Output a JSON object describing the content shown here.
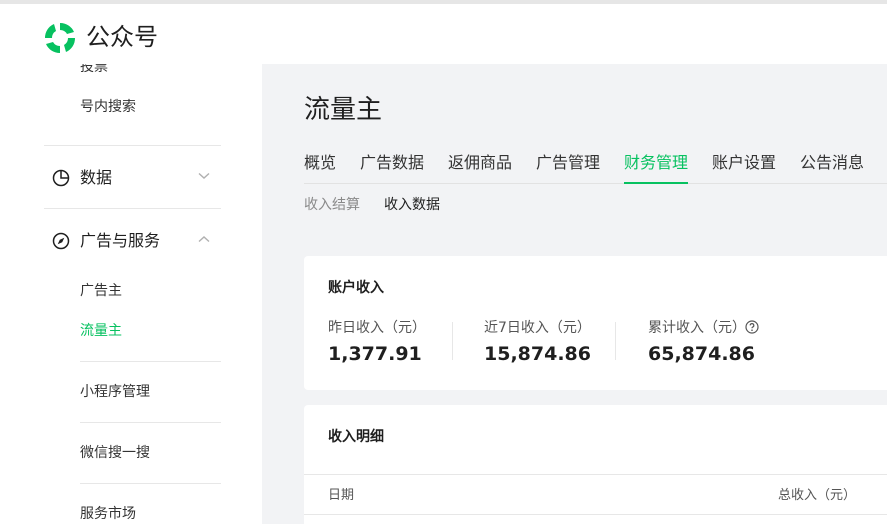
{
  "app": {
    "name": "公众号"
  },
  "colors": {
    "accent": "#07c160"
  },
  "sidebar": {
    "top_items": [
      {
        "label": "投票"
      },
      {
        "label": "号内搜索"
      }
    ],
    "groups": [
      {
        "label": "数据",
        "icon": "pie-chart-icon",
        "expanded": false
      },
      {
        "label": "广告与服务",
        "icon": "compass-icon",
        "expanded": true
      }
    ],
    "ad_service_items": [
      {
        "label": "广告主",
        "active": false
      },
      {
        "label": "流量主",
        "active": true
      }
    ],
    "bottom_items": [
      {
        "label": "小程序管理"
      },
      {
        "label": "微信搜一搜"
      },
      {
        "label": "服务市场"
      }
    ]
  },
  "main": {
    "title": "流量主",
    "tabs": [
      {
        "label": "概览",
        "active": false
      },
      {
        "label": "广告数据",
        "active": false
      },
      {
        "label": "返佣商品",
        "active": false
      },
      {
        "label": "广告管理",
        "active": false
      },
      {
        "label": "财务管理",
        "active": true
      },
      {
        "label": "账户设置",
        "active": false
      },
      {
        "label": "公告消息",
        "active": false
      }
    ],
    "subtabs": [
      {
        "label": "收入结算",
        "active": false
      },
      {
        "label": "收入数据",
        "active": true
      }
    ],
    "account_income": {
      "title": "账户收入",
      "stats": [
        {
          "label": "昨日收入（元）",
          "value": "1,377.91"
        },
        {
          "label": "近7日收入（元）",
          "value": "15,874.86"
        },
        {
          "label": "累计收入（元）",
          "value": "65,874.86",
          "help_icon": "question-circle-icon"
        }
      ]
    },
    "income_detail": {
      "title": "收入明细",
      "columns": [
        "日期",
        "总收入（元）"
      ]
    }
  }
}
